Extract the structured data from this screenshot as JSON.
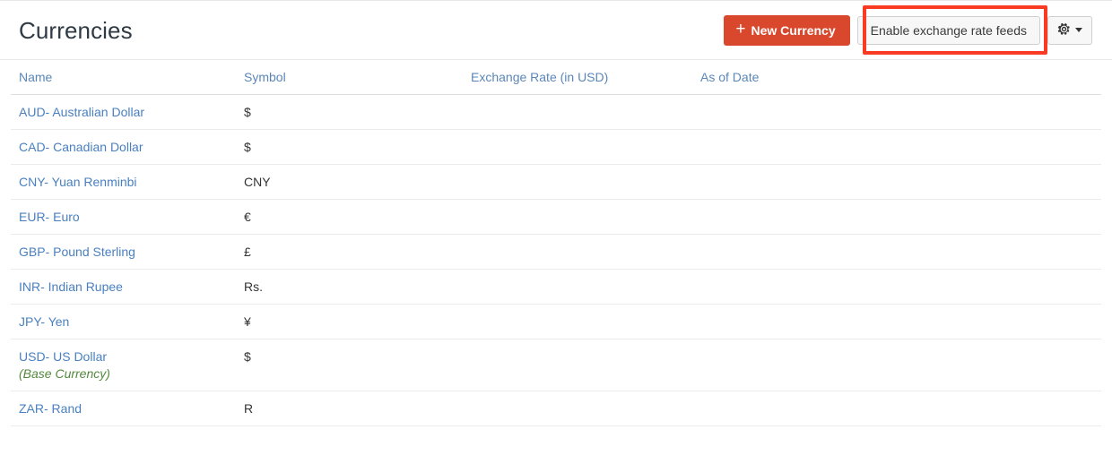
{
  "header": {
    "title": "Currencies",
    "new_currency_label": "New Currency",
    "new_currency_icon": "plus-icon",
    "enable_feeds_label": "Enable exchange rate feeds",
    "settings_icon": "gear-icon",
    "settings_caret_icon": "chevron-down-icon",
    "primary_button_color": "#d9482d",
    "annotation_color": "#f93b23"
  },
  "table": {
    "columns": [
      "Name",
      "Symbol",
      "Exchange Rate (in USD)",
      "As of Date"
    ],
    "rows": [
      {
        "name": "AUD- Australian Dollar",
        "symbol": "$",
        "rate": "",
        "as_of_date": "",
        "note": ""
      },
      {
        "name": "CAD- Canadian Dollar",
        "symbol": "$",
        "rate": "",
        "as_of_date": "",
        "note": ""
      },
      {
        "name": "CNY- Yuan Renminbi",
        "symbol": "CNY",
        "rate": "",
        "as_of_date": "",
        "note": ""
      },
      {
        "name": "EUR- Euro",
        "symbol": "€",
        "rate": "",
        "as_of_date": "",
        "note": ""
      },
      {
        "name": "GBP- Pound Sterling",
        "symbol": "£",
        "rate": "",
        "as_of_date": "",
        "note": ""
      },
      {
        "name": "INR- Indian Rupee",
        "symbol": "Rs.",
        "rate": "",
        "as_of_date": "",
        "note": ""
      },
      {
        "name": "JPY- Yen",
        "symbol": "¥",
        "rate": "",
        "as_of_date": "",
        "note": ""
      },
      {
        "name": "USD- US Dollar",
        "symbol": "$",
        "rate": "",
        "as_of_date": "",
        "note": "(Base Currency)"
      },
      {
        "name": "ZAR- Rand",
        "symbol": "R",
        "rate": "",
        "as_of_date": "",
        "note": ""
      }
    ]
  }
}
